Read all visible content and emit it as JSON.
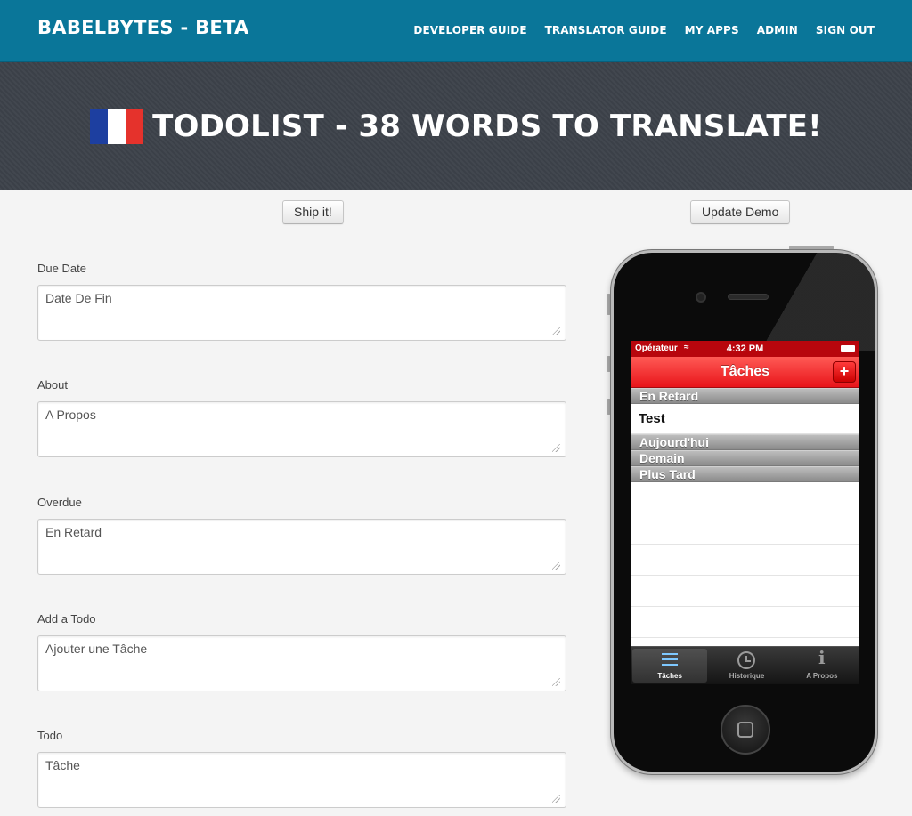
{
  "navbar": {
    "brand": "BABELBYTES - BETA",
    "links": [
      "DEVELOPER GUIDE",
      "TRANSLATOR GUIDE",
      "MY APPS",
      "ADMIN",
      "SIGN OUT"
    ]
  },
  "hero": {
    "title": "TODOLIST - 38 WORDS TO TRANSLATE!",
    "flag_icon": "france-flag-icon"
  },
  "actions": {
    "ship_label": "Ship it!",
    "update_demo_label": "Update Demo"
  },
  "fields": [
    {
      "label": "Due Date",
      "value": "Date De Fin"
    },
    {
      "label": "About",
      "value": "A Propos"
    },
    {
      "label": "Overdue",
      "value": "En Retard"
    },
    {
      "label": "Add a Todo",
      "value": "Ajouter une Tâche"
    },
    {
      "label": "Todo",
      "value": "Tâche"
    }
  ],
  "phone": {
    "status": {
      "carrier": "Opérateur",
      "time": "4:32 PM"
    },
    "title": "Tâches",
    "add_symbol": "+",
    "sections": [
      {
        "header": "En Retard",
        "items": [
          "Test"
        ]
      },
      {
        "header": "Aujourd'hui",
        "items": []
      },
      {
        "header": "Demain",
        "items": []
      },
      {
        "header": "Plus Tard",
        "items": []
      }
    ],
    "tabs": [
      {
        "label": "Tâches",
        "icon": "list-icon",
        "active": true
      },
      {
        "label": "Historique",
        "icon": "clock-icon",
        "active": false
      },
      {
        "label": "A Propos",
        "icon": "info-icon",
        "active": false
      }
    ]
  },
  "colors": {
    "navbar": "#0a7699",
    "hero": "#3d434b",
    "phone_red": "#e8141a"
  }
}
